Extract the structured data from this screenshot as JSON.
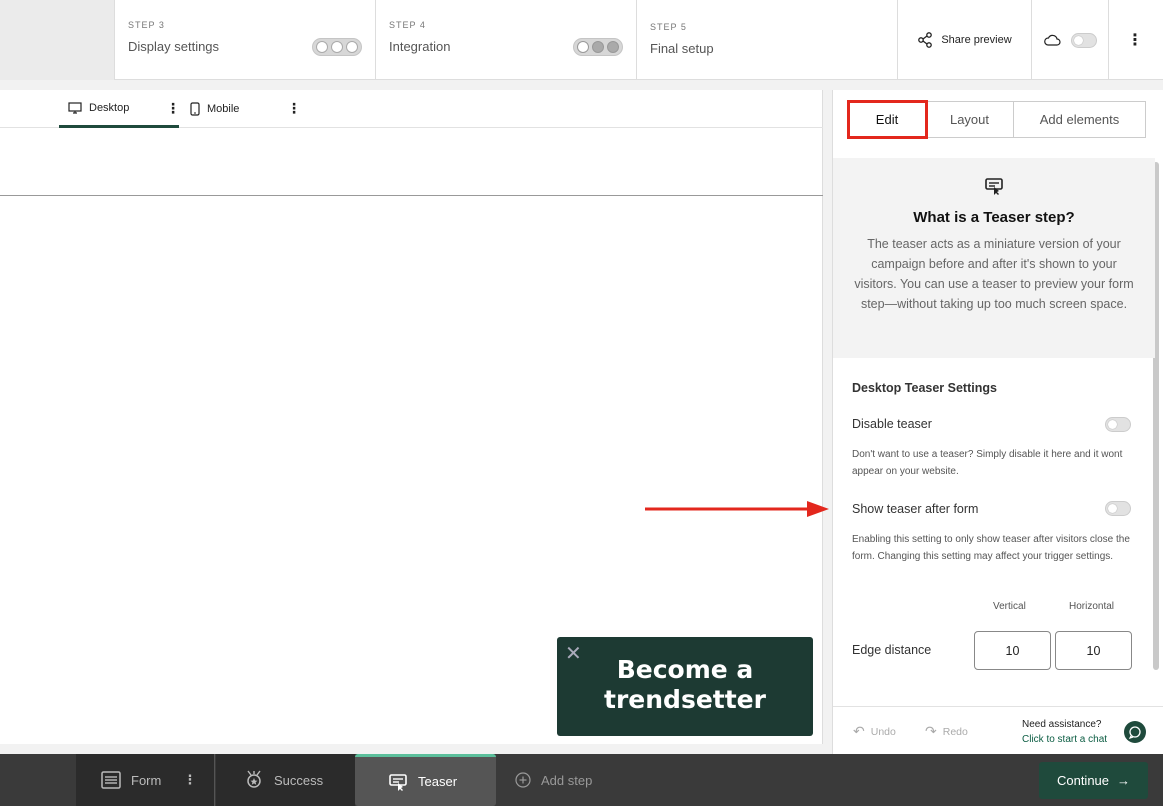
{
  "steps": [
    {
      "num": "STEP 3",
      "title": "Display settings"
    },
    {
      "num": "STEP 4",
      "title": "Integration"
    },
    {
      "num": "STEP 5",
      "title": "Final setup"
    }
  ],
  "topbar": {
    "share_label": "Share preview",
    "menu_icon": "kebab-icon"
  },
  "device_tabs": {
    "desktop": "Desktop",
    "mobile": "Mobile"
  },
  "teaser_preview": {
    "text": "Become a trendsetter"
  },
  "panel": {
    "tabs": {
      "edit": "Edit",
      "layout": "Layout",
      "add": "Add elements"
    },
    "info_title": "What is a Teaser step?",
    "info_body": "The teaser acts as a miniature version of your campaign before and after it's shown to your visitors. You can use a teaser to preview your form step—without taking up too much screen space.",
    "section_title": "Desktop Teaser Settings",
    "disable_label": "Disable teaser",
    "disable_help": "Don't want to use a teaser? Simply disable it here and it wont appear on your website.",
    "show_after_label": "Show teaser after form",
    "show_after_help": "Enabling this setting to only show teaser after visitors close the form. Changing this setting may affect your trigger settings.",
    "vertical_label": "Vertical",
    "horizontal_label": "Horizontal",
    "edge_label": "Edge distance",
    "vertical_value": "10",
    "horizontal_value": "10",
    "undo": "Undo",
    "redo": "Redo",
    "assist_q": "Need assistance?",
    "assist_link": "Click to start a chat"
  },
  "bottombar": {
    "form": "Form",
    "success": "Success",
    "teaser": "Teaser",
    "add_step": "Add step",
    "continue": "Continue"
  },
  "colors": {
    "brand": "#1f4a3c",
    "highlight": "#e3271d",
    "accent": "#5bbf9b"
  }
}
